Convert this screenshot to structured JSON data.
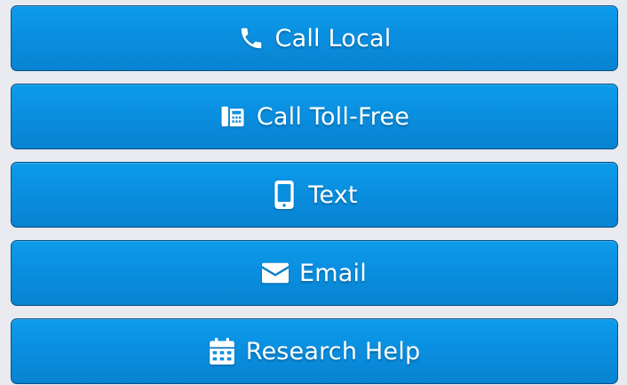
{
  "accent_color": "#0a8fe0",
  "buttons": [
    {
      "label": "Call Local",
      "icon": "phone-icon"
    },
    {
      "label": "Call Toll-Free",
      "icon": "fax-icon"
    },
    {
      "label": "Text",
      "icon": "mobile-icon"
    },
    {
      "label": "Email",
      "icon": "envelope-icon"
    },
    {
      "label": "Research Help",
      "icon": "calendar-icon"
    }
  ]
}
